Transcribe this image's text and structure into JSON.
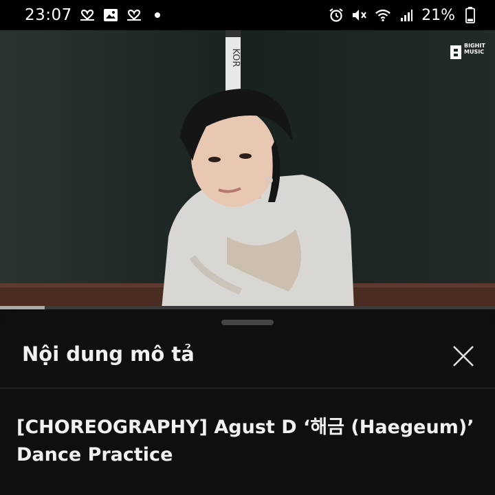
{
  "status_bar": {
    "time": "23:07",
    "left_icons": [
      "heart-link-icon",
      "image-icon",
      "heart-link-icon",
      "dot-icon"
    ],
    "right_icons": [
      "alarm-icon",
      "mute-icon",
      "wifi-icon",
      "signal-icon"
    ],
    "battery_percent": "21%",
    "battery_level": 0.21
  },
  "video": {
    "channel_watermark": "BIGHIT MUSIC",
    "progress_fraction": 0.09
  },
  "panel": {
    "title": "Nội dung mô tả",
    "close_icon": "close-icon",
    "video_title": "[CHOREOGRAPHY] Agust D ‘해금 (Haegeum)’ Dance Practice"
  }
}
